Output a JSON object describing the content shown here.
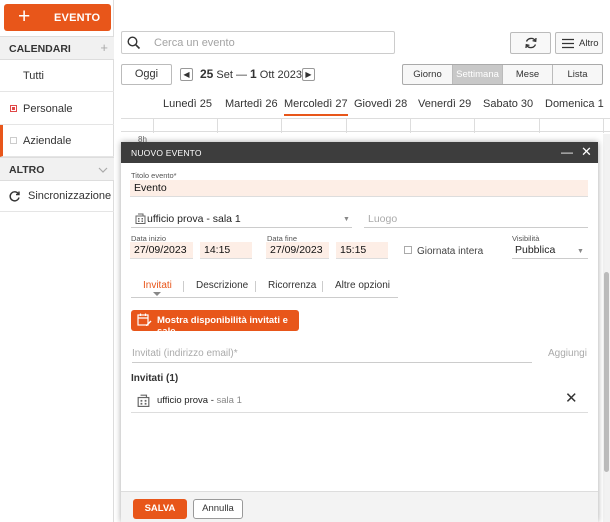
{
  "sidebar": {
    "new_event_label": "EVENTO",
    "calendars_header": "CALENDARI",
    "add_symbol": "+",
    "items": [
      {
        "label": "Tutti"
      },
      {
        "label": "Personale",
        "color": "#e04848"
      },
      {
        "label": "Aziendale",
        "color": "#dddddd"
      }
    ],
    "altro_header": "ALTRO",
    "sync_label": "Sincronizzazione"
  },
  "toolbar": {
    "search_placeholder": "Cerca un evento",
    "altro_label": "Altro",
    "today_label": "Oggi",
    "range_start_day": "25",
    "range_start_rest": " Set — ",
    "range_end_day": "1",
    "range_end_rest": " Ott 2023",
    "views": [
      "Giorno",
      "Settimana",
      "Mese",
      "Lista"
    ],
    "active_view": "Settimana"
  },
  "week": {
    "days": [
      "Lunedì 25",
      "Martedì 26",
      "Mercoledì 27",
      "Giovedì 28",
      "Venerdì 29",
      "Sabato 30",
      "Domenica 1"
    ],
    "today": "Mercoledì 27",
    "first_hour": "8h"
  },
  "modal": {
    "title": "NUOVO EVENTO",
    "title_label": "Titolo evento*",
    "title_value": "Evento",
    "room_value": "ufficio prova - sala 1",
    "luogo_placeholder": "Luogo",
    "start_label": "Data inizio",
    "start_date": "27/09/2023",
    "start_time": "14:15",
    "end_label": "Data fine",
    "end_date": "27/09/2023",
    "end_time": "15:15",
    "all_day_label": "Giornata intera",
    "visibility_label": "Visibilità",
    "visibility_value": "Pubblica",
    "tabs": [
      "Invitati",
      "Descrizione",
      "Ricorrenza",
      "Altre opzioni"
    ],
    "active_tab": "Invitati",
    "availability_label": "Mostra disponibilità invitati e sale",
    "invite_placeholder": "Invitati (indirizzo email)*",
    "add_label": "Aggiungi",
    "invitees_header": "Invitati (1)",
    "invitees": [
      {
        "name": "ufficio prova - ",
        "room": "sala 1"
      }
    ],
    "save_label": "SALVA",
    "cancel_label": "Annulla"
  },
  "colors": {
    "accent": "#e8561a",
    "field_bg": "#fdeee6",
    "modal_header": "#3d3d3d"
  }
}
